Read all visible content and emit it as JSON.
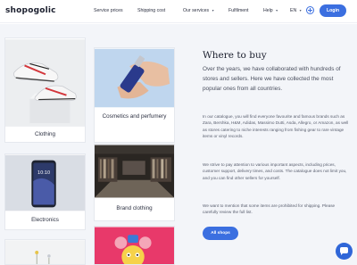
{
  "header": {
    "logo": "shopogolic",
    "nav": [
      {
        "label": "Service prices",
        "caret": ""
      },
      {
        "label": "Shipping cost",
        "caret": ""
      },
      {
        "label": "Our services",
        "caret": "▾"
      },
      {
        "label": "Fulfilment",
        "caret": ""
      },
      {
        "label": "Help",
        "caret": "▾"
      }
    ],
    "language": {
      "label": "EN",
      "caret": "▾"
    },
    "login_label": "Login"
  },
  "categories": [
    {
      "label": "Clothing",
      "icon": "sneakers-image"
    },
    {
      "label": "Cosmetics and perfumery",
      "icon": "perfume-image"
    },
    {
      "label": "Electronics",
      "icon": "smartphone-image"
    },
    {
      "label": "Brand clothing",
      "icon": "clothing-store-image"
    }
  ],
  "content": {
    "title": "Where to buy",
    "intro": "Over the years, we have collaborated with hundreds of stores and sellers. Here we have collected the most popular ones from all countries.",
    "paragraphs": [
      "In our catalogue, you will find everyone favourite and famous brands such as Zara, Bershka, H&M, Adidas, Massimo Dutti, Asda, Allegro, or Amazon, as well as stores catering to niche interests ranging from fishing gear to rare vintage items or vinyl records.",
      "We strive to pay attention to various important aspects, including prices, customer support, delivery times, and costs. The catalogue does not limit you, and you can find other sellers for yourself.",
      "We want to mention that some items are prohibited for shipping. Please carefully review the full list."
    ],
    "cta_label": "All shops"
  },
  "colors": {
    "accent": "#3b6fe0",
    "page_bg": "#f3f5f9"
  }
}
